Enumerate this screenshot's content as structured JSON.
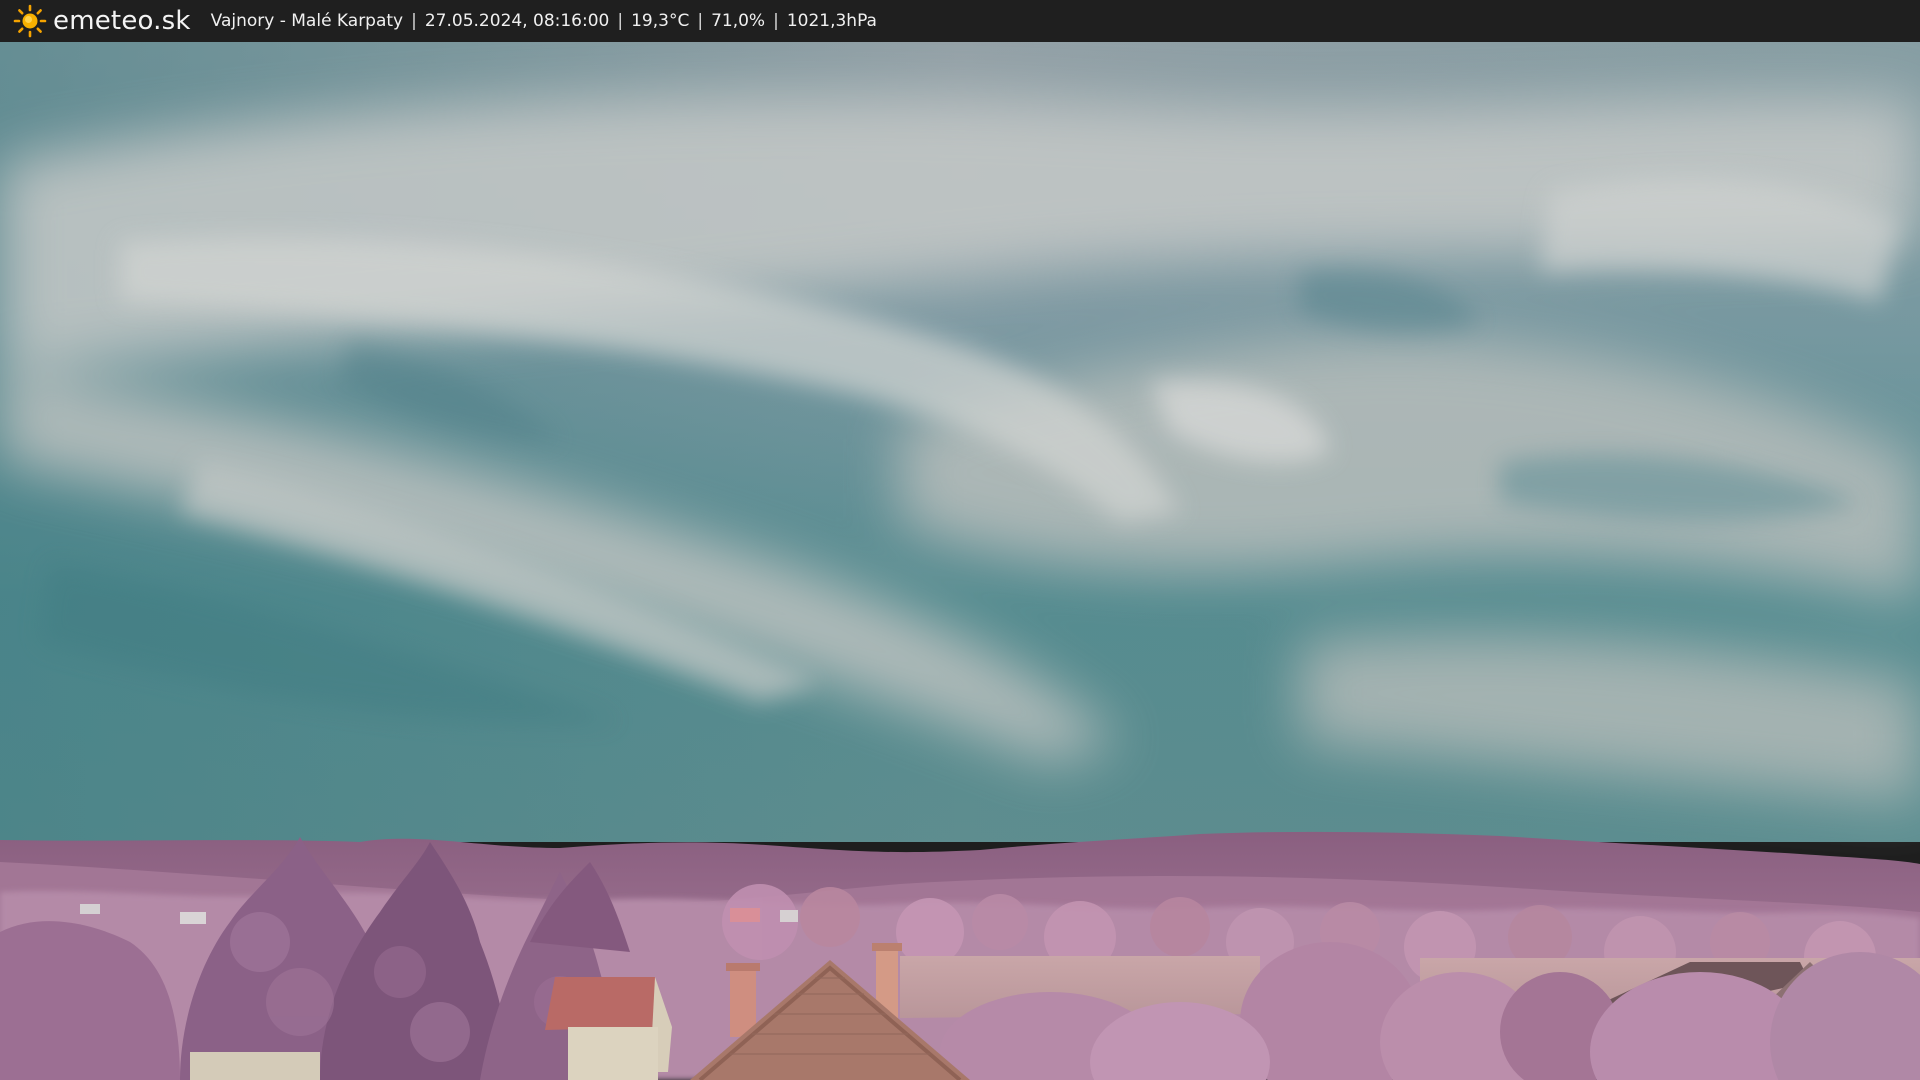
{
  "header": {
    "brand": "emeteo.sk",
    "location": "Vajnory - Malé Karpaty",
    "datetime": "27.05.2024, 08:16:00",
    "temperature": "19,3°C",
    "humidity": "71,0%",
    "pressure": "1021,3hPa",
    "separator": "|",
    "logo_icon": "sun-icon"
  },
  "colors": {
    "bar": "#1f1f1f",
    "sun": "#f5a300",
    "sky_top": "#8e9ca3",
    "sky_bottom": "#4f8a8c",
    "hills": "#9a6f8e",
    "foliage": "#b88aaa"
  }
}
